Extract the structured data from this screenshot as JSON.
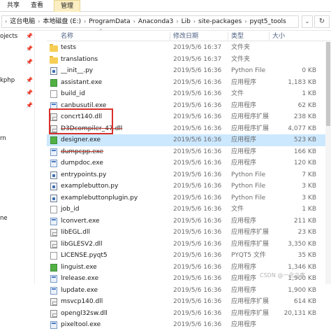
{
  "ribbon": {
    "tabs": [
      "共享",
      "查看",
      "管理"
    ]
  },
  "address": {
    "crumbs": [
      "这台电脑",
      "本地磁盘 (E:)",
      "ProgramData",
      "Anaconda3",
      "Lib",
      "site-packages",
      "pyqt5_tools"
    ]
  },
  "nav": {
    "items": [
      "ojects",
      "kphp",
      "rn",
      "ne"
    ]
  },
  "columns": {
    "name": "名称",
    "date": "修改日期",
    "type": "类型",
    "size": "大小"
  },
  "files": [
    {
      "name": "tests",
      "date": "2019/5/6 16:37",
      "type": "文件夹",
      "size": "",
      "icon": "folder-icon"
    },
    {
      "name": "translations",
      "date": "2019/5/6 16:37",
      "type": "文件夹",
      "size": "",
      "icon": "folder-icon"
    },
    {
      "name": "__init__.py",
      "date": "2019/5/6 16:36",
      "type": "Python File",
      "size": "0 KB",
      "icon": "python-file-icon"
    },
    {
      "name": "assistant.exe",
      "date": "2019/5/6 16:36",
      "type": "应用程序",
      "size": "1,183 KB",
      "icon": "qt-app-icon"
    },
    {
      "name": "build_id",
      "date": "2019/5/6 16:36",
      "type": "文件",
      "size": "1 KB",
      "icon": "file-icon"
    },
    {
      "name": "canbusutil.exe",
      "date": "2019/5/6 16:36",
      "type": "应用程序",
      "size": "62 KB",
      "icon": "exe-icon"
    },
    {
      "name": "concrt140.dll",
      "date": "2019/5/6 16:36",
      "type": "应用程序扩展",
      "size": "238 KB",
      "icon": "dll-icon"
    },
    {
      "name": "D3Dcompiler_47.dll",
      "date": "2019/5/6 16:36",
      "type": "应用程序扩展",
      "size": "4,077 KB",
      "icon": "dll-icon"
    },
    {
      "name": "designer.exe",
      "date": "2019/5/6 16:36",
      "type": "应用程序",
      "size": "523 KB",
      "icon": "qt-app-icon"
    },
    {
      "name": "dumpcpp.exe",
      "date": "2019/5/6 16:36",
      "type": "应用程序",
      "size": "166 KB",
      "icon": "exe-icon"
    },
    {
      "name": "dumpdoc.exe",
      "date": "2019/5/6 16:36",
      "type": "应用程序",
      "size": "120 KB",
      "icon": "exe-icon"
    },
    {
      "name": "entrypoints.py",
      "date": "2019/5/6 16:36",
      "type": "Python File",
      "size": "7 KB",
      "icon": "python-file-icon"
    },
    {
      "name": "examplebutton.py",
      "date": "2019/5/6 16:36",
      "type": "Python File",
      "size": "3 KB",
      "icon": "python-file-icon"
    },
    {
      "name": "examplebuttonplugin.py",
      "date": "2019/5/6 16:36",
      "type": "Python File",
      "size": "3 KB",
      "icon": "python-file-icon"
    },
    {
      "name": "job_id",
      "date": "2019/5/6 16:36",
      "type": "文件",
      "size": "1 KB",
      "icon": "file-icon"
    },
    {
      "name": "lconvert.exe",
      "date": "2019/5/6 16:36",
      "type": "应用程序",
      "size": "211 KB",
      "icon": "exe-icon"
    },
    {
      "name": "libEGL.dll",
      "date": "2019/5/6 16:36",
      "type": "应用程序扩展",
      "size": "23 KB",
      "icon": "dll-icon"
    },
    {
      "name": "libGLESV2.dll",
      "date": "2019/5/6 16:36",
      "type": "应用程序扩展",
      "size": "3,350 KB",
      "icon": "dll-icon"
    },
    {
      "name": "LICENSE.pyqt5",
      "date": "2019/5/6 16:36",
      "type": "PYQT5 文件",
      "size": "35 KB",
      "icon": "file-icon"
    },
    {
      "name": "linguist.exe",
      "date": "2019/5/6 16:36",
      "type": "应用程序",
      "size": "1,346 KB",
      "icon": "qt-app-icon"
    },
    {
      "name": "lrelease.exe",
      "date": "2019/5/6 16:36",
      "type": "应用程序",
      "size": "1,900 KB",
      "icon": "exe-icon"
    },
    {
      "name": "lupdate.exe",
      "date": "2019/5/6 16:36",
      "type": "应用程序",
      "size": "1,900 KB",
      "icon": "exe-icon"
    },
    {
      "name": "msvcp140.dll",
      "date": "2019/5/6 16:36",
      "type": "应用程序扩展",
      "size": "614 KB",
      "icon": "dll-icon"
    },
    {
      "name": "opengl32sw.dll",
      "date": "2019/5/6 16:36",
      "type": "应用程序扩展",
      "size": "20,131 KB",
      "icon": "dll-icon"
    },
    {
      "name": "pixeltool.exe",
      "date": "2019/5/6 16:36",
      "type": "应用程序",
      "size": "",
      "icon": "exe-icon"
    }
  ],
  "selected_index": 8,
  "watermark": "CSDN @一念之客"
}
